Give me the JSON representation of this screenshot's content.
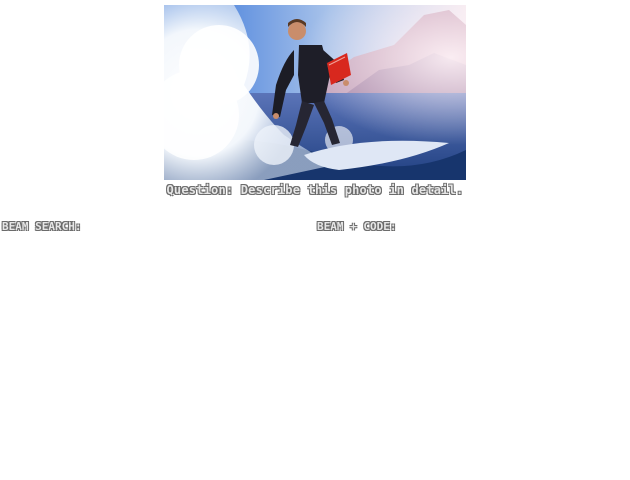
{
  "question": "Question: Describe this photo in detail.",
  "columns": {
    "left_label": "BEAM SEARCH:",
    "right_label": "BEAM + CODE:"
  }
}
